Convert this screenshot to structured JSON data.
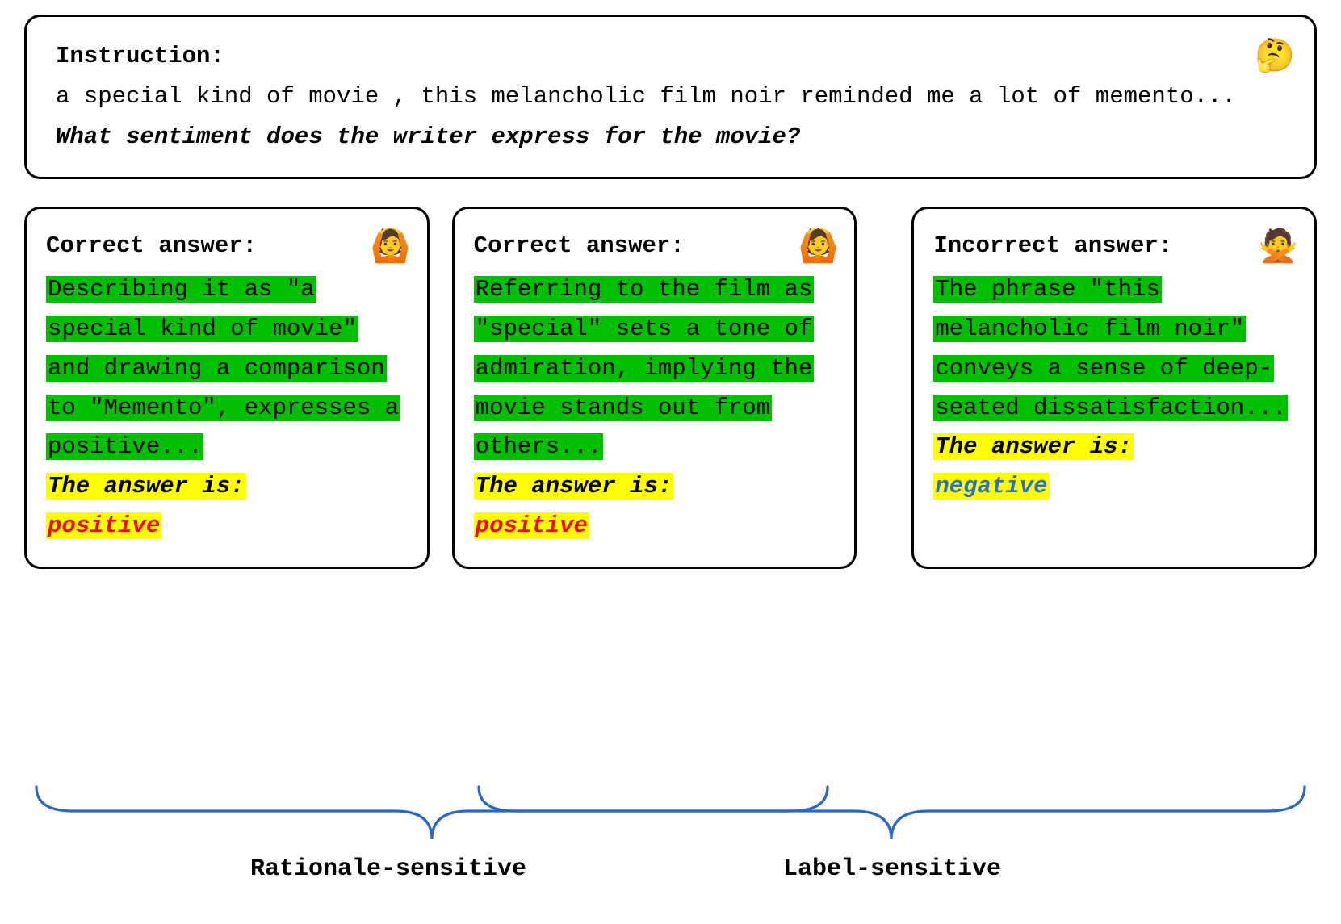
{
  "instruction": {
    "label": "Instruction:",
    "body": "a special kind of movie , this melancholic film noir reminded me a lot of memento...",
    "question": "What sentiment does the writer express for the movie?",
    "emoji": "🤔"
  },
  "cards": [
    {
      "title": "Correct answer:",
      "emoji": "🙆",
      "rationale": "Describing it as \"a special kind of movie\" and drawing a comparison to \"Memento\", expresses a positive...",
      "answer_prefix": "The answer is:",
      "answer_value": "positive",
      "answer_style": "red"
    },
    {
      "title": "Correct answer:",
      "emoji": "🙆",
      "rationale": "Referring to the film as \"special\" sets a tone of admiration, implying the movie stands out from others...",
      "answer_prefix": "The answer is:",
      "answer_value": "positive",
      "answer_style": "red"
    },
    {
      "title": "Incorrect answer:",
      "emoji": "🙅",
      "rationale": "The phrase \"this melancholic film noir\" conveys a sense of deep-seated dissatisfaction...",
      "answer_prefix": "The answer is:",
      "answer_value": "negative",
      "answer_style": "blue"
    }
  ],
  "groups": {
    "left_label": "Rationale-sensitive",
    "right_label": "Label-sensitive"
  }
}
